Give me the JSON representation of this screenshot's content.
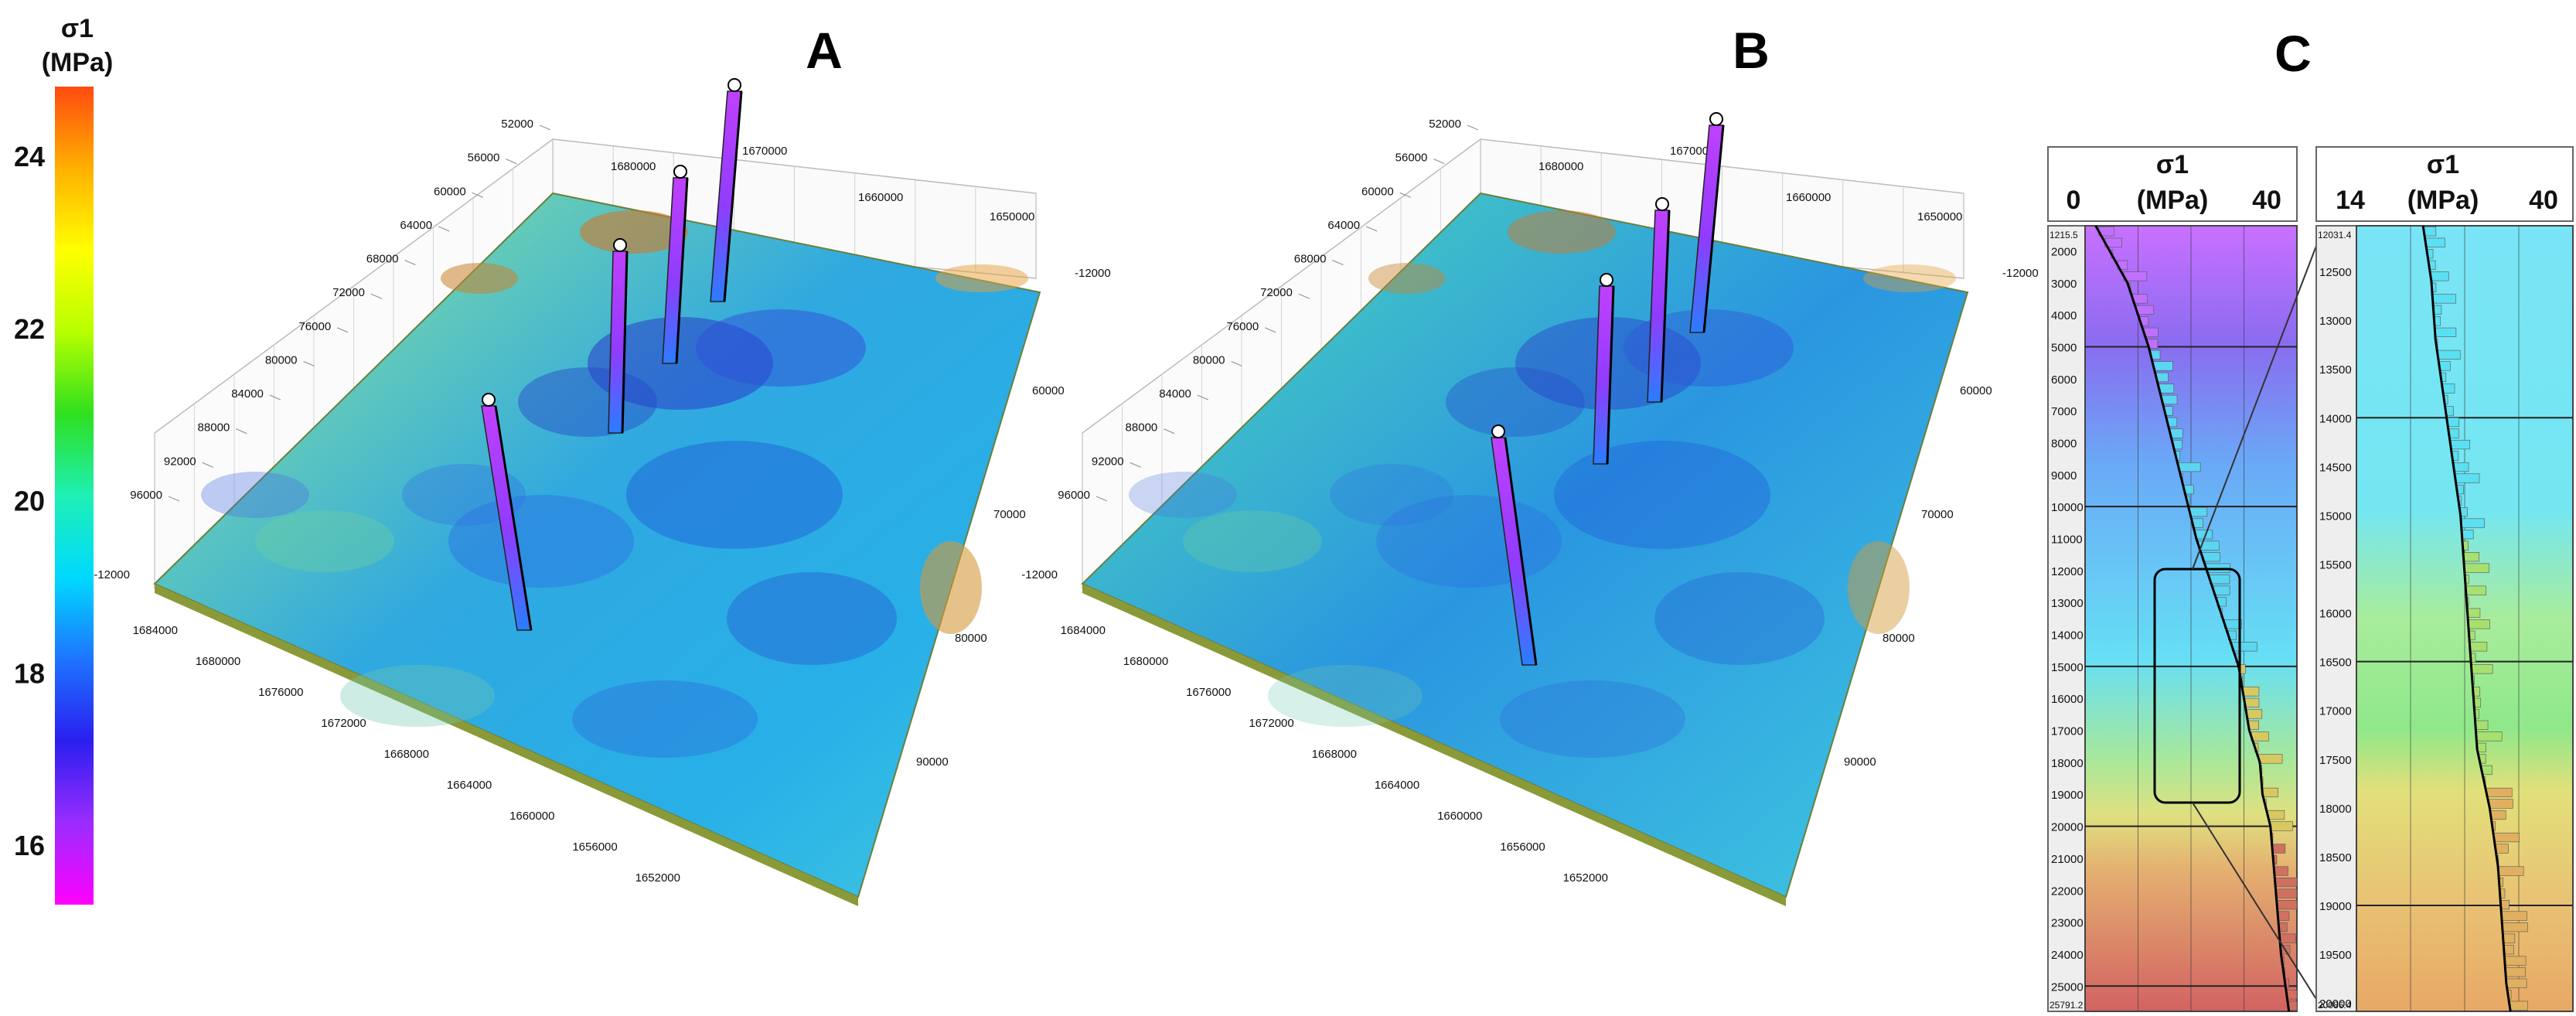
{
  "colorbar": {
    "title_symbol": "σ1",
    "title_unit": "(MPa)",
    "ticks": [
      "24",
      "22",
      "20",
      "18",
      "16"
    ],
    "tick_values": [
      24,
      22,
      20,
      18,
      16
    ],
    "range": [
      15.3,
      24.8
    ],
    "colors": [
      "#ff00ff",
      "#9b2cff",
      "#2a1ff0",
      "#1e74ff",
      "#00d9ff",
      "#1ef0b4",
      "#2ee01e",
      "#b8ff00",
      "#ffff00",
      "#ffb000",
      "#ff4a10"
    ]
  },
  "panels": {
    "a": {
      "letter": "A",
      "y_ticks": [
        "52000",
        "56000",
        "60000",
        "64000",
        "68000",
        "72000",
        "76000",
        "80000",
        "84000",
        "88000",
        "92000",
        "96000"
      ],
      "x_ticks_top": [
        "1680000",
        "1670000",
        "1660000",
        "1650000"
      ],
      "x_ticks_bottom": [
        "1684000",
        "1680000",
        "1676000",
        "1672000",
        "1668000",
        "1664000",
        "1660000",
        "1656000",
        "1652000"
      ],
      "right_ticks": [
        "60000",
        "70000",
        "80000",
        "90000"
      ],
      "z_ticks": [
        "-12000",
        "-12000"
      ]
    },
    "b": {
      "letter": "B",
      "y_ticks": [
        "52000",
        "56000",
        "60000",
        "64000",
        "68000",
        "72000",
        "76000",
        "80000",
        "84000",
        "88000",
        "92000",
        "96000"
      ],
      "x_ticks_top": [
        "1680000",
        "1670000",
        "1660000",
        "1650000"
      ],
      "x_ticks_bottom": [
        "1684000",
        "1680000",
        "1676000",
        "1672000",
        "1668000",
        "1664000",
        "1660000",
        "1656000",
        "1652000"
      ],
      "right_ticks": [
        "60000",
        "70000",
        "80000",
        "90000"
      ],
      "z_ticks": [
        "-12000",
        "-12000"
      ]
    },
    "c": {
      "letter": "C"
    }
  },
  "chart_data": [
    {
      "type": "heatmap",
      "panel": "A",
      "view": "3D surface with wells",
      "color_field": "σ1 (MPa)",
      "wells": 4
    },
    {
      "type": "heatmap",
      "panel": "B",
      "view": "3D surface with wells",
      "color_field": "σ1 (MPa)",
      "wells": 4
    },
    {
      "type": "bar",
      "panel": "C-full",
      "title": "σ1",
      "unit": "(MPa)",
      "x_tick_labels": [
        "0",
        "40"
      ],
      "xlim": [
        0,
        40
      ],
      "depth_top_label": "1215.5",
      "depth_bottom_label": "25791.2",
      "depth_ticks": [
        "2000",
        "3000",
        "4000",
        "5000",
        "6000",
        "7000",
        "8000",
        "9000",
        "10000",
        "11000",
        "12000",
        "13000",
        "14000",
        "15000",
        "16000",
        "17000",
        "18000",
        "19000",
        "20000",
        "21000",
        "22000",
        "23000",
        "24000",
        "25000"
      ],
      "depth_ticks_values": [
        2000,
        3000,
        4000,
        5000,
        6000,
        7000,
        8000,
        9000,
        10000,
        11000,
        12000,
        13000,
        14000,
        15000,
        16000,
        17000,
        18000,
        19000,
        20000,
        21000,
        22000,
        23000,
        24000,
        25000
      ],
      "ylim": [
        1215.5,
        25791.2
      ],
      "profile_depth": [
        1215.5,
        3000,
        5000,
        7000,
        9000,
        11000,
        12000,
        13000,
        14000,
        15000,
        16000,
        17000,
        18000,
        19000,
        20000,
        22000,
        24000,
        25791.2
      ],
      "profile_sigma1": [
        2,
        8,
        12,
        15,
        18,
        21,
        23,
        25,
        27,
        29,
        30,
        31,
        33,
        33.5,
        35,
        36,
        37,
        38.5
      ]
    },
    {
      "type": "bar",
      "panel": "C-zoom",
      "title": "σ1",
      "unit": "(MPa)",
      "x_tick_labels": [
        "14",
        "40"
      ],
      "xlim": [
        14,
        40
      ],
      "depth_top_label": "12031.4",
      "depth_bottom_label": "20086.4",
      "depth_ticks": [
        "12500",
        "13000",
        "13500",
        "14000",
        "14500",
        "15000",
        "15500",
        "16000",
        "16500",
        "17000",
        "17500",
        "18000",
        "18500",
        "19000",
        "19500",
        "20000"
      ],
      "depth_ticks_values": [
        12500,
        13000,
        13500,
        14000,
        14500,
        15000,
        15500,
        16000,
        16500,
        17000,
        17500,
        18000,
        18500,
        19000,
        19500,
        20000
      ],
      "ylim": [
        12031.4,
        20086.4
      ],
      "profile_depth": [
        12031.4,
        12600,
        13200,
        13800,
        14400,
        15000,
        15600,
        16200,
        16800,
        17400,
        18000,
        18600,
        19200,
        19800,
        20086.4
      ],
      "profile_sigma1": [
        22,
        23,
        23.5,
        24.5,
        25.5,
        26.5,
        27,
        27.5,
        28,
        28.5,
        30,
        31,
        31.5,
        32,
        32.5
      ]
    }
  ]
}
